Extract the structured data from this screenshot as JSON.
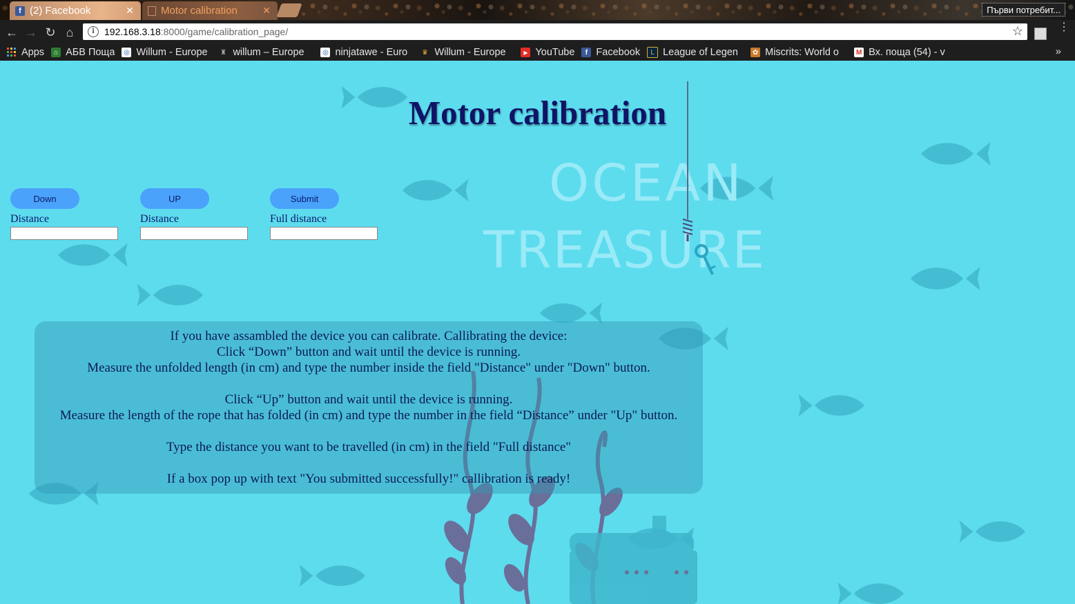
{
  "browser": {
    "tabs": [
      {
        "title": "(2) Facebook",
        "favicon": "facebook-icon"
      },
      {
        "title": "Motor calibration",
        "favicon": "page-icon"
      }
    ],
    "profile_label": "Първи потребит...",
    "url_host": "192.168.3.18",
    "url_rest": ":8000/game/calibration_page/",
    "bookmarks": [
      {
        "label": "Apps",
        "icon": "apps-grid-icon"
      },
      {
        "label": "АБВ Поща",
        "icon": "abv-house-icon"
      },
      {
        "label": "Willum - Europe",
        "icon": "willum-icon"
      },
      {
        "label": "willum – Europe",
        "icon": "willum-castle-icon"
      },
      {
        "label": "ninjatawe - Euro",
        "icon": "ninja-icon"
      },
      {
        "label": "Willum - Europe",
        "icon": "crown-icon"
      },
      {
        "label": "YouTube",
        "icon": "youtube-icon"
      },
      {
        "label": "Facebook",
        "icon": "facebook-icon"
      },
      {
        "label": "League of Legen",
        "icon": "league-icon"
      },
      {
        "label": "Miscrits: World o",
        "icon": "miscrits-icon"
      },
      {
        "label": "Вх. поща (54) - v",
        "icon": "gmail-icon"
      }
    ],
    "more_label": "»"
  },
  "page": {
    "title": "Motor calibration",
    "logo_top": "OCEAN",
    "logo_bottom": "TREASURE",
    "controls": [
      {
        "button": "Down",
        "label": "Distance",
        "value": ""
      },
      {
        "button": "UP",
        "label": "Distance",
        "value": ""
      },
      {
        "button": "Submit",
        "label": "Full distance",
        "value": ""
      }
    ],
    "instructions": [
      "If you have assambled the device you can calibrate. Callibrating the device:",
      "Click “Down” button and wait until the device is running.",
      "Measure the unfolded length (in cm) and type the number inside the field \"Distance\" under \"Down\" button.",
      "",
      "Click “Up” button and wait until the device is running.",
      "Measure the length of the rope that has folded (in cm) and type the number in the field “Distance” under \"Up\" button.",
      "",
      "Type the distance you want to be travelled (in cm) in the field \"Full distance\"",
      "",
      "If a box pop up with text \"You submitted successfully!\" callibration is ready!"
    ]
  },
  "colors": {
    "page_background": "#5ddcee",
    "title": "#0f1466",
    "button": "#4aa2fb",
    "text": "#0c1a55"
  }
}
